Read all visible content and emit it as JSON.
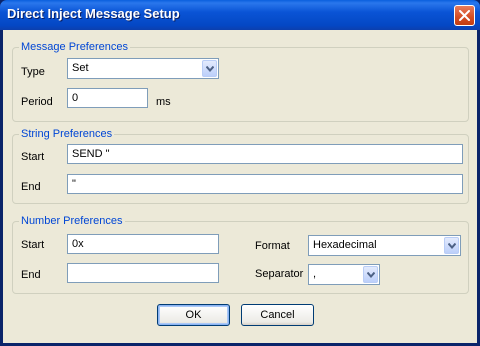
{
  "window": {
    "title": "Direct Inject Message Setup"
  },
  "message_preferences": {
    "legend": "Message Preferences",
    "type_label": "Type",
    "type_value": "Set",
    "period_label": "Period",
    "period_value": "0",
    "period_unit": "ms"
  },
  "string_preferences": {
    "legend": "String Preferences",
    "start_label": "Start",
    "start_value": "SEND \"",
    "end_label": "End",
    "end_value": "\""
  },
  "number_preferences": {
    "legend": "Number Preferences",
    "start_label": "Start",
    "start_value": "0x",
    "end_label": "End",
    "end_value": "",
    "format_label": "Format",
    "format_value": "Hexadecimal",
    "separator_label": "Separator",
    "separator_value": ","
  },
  "buttons": {
    "ok": "OK",
    "cancel": "Cancel"
  },
  "icons": {
    "close": "close-icon",
    "dropdown": "chevron-down-icon"
  }
}
